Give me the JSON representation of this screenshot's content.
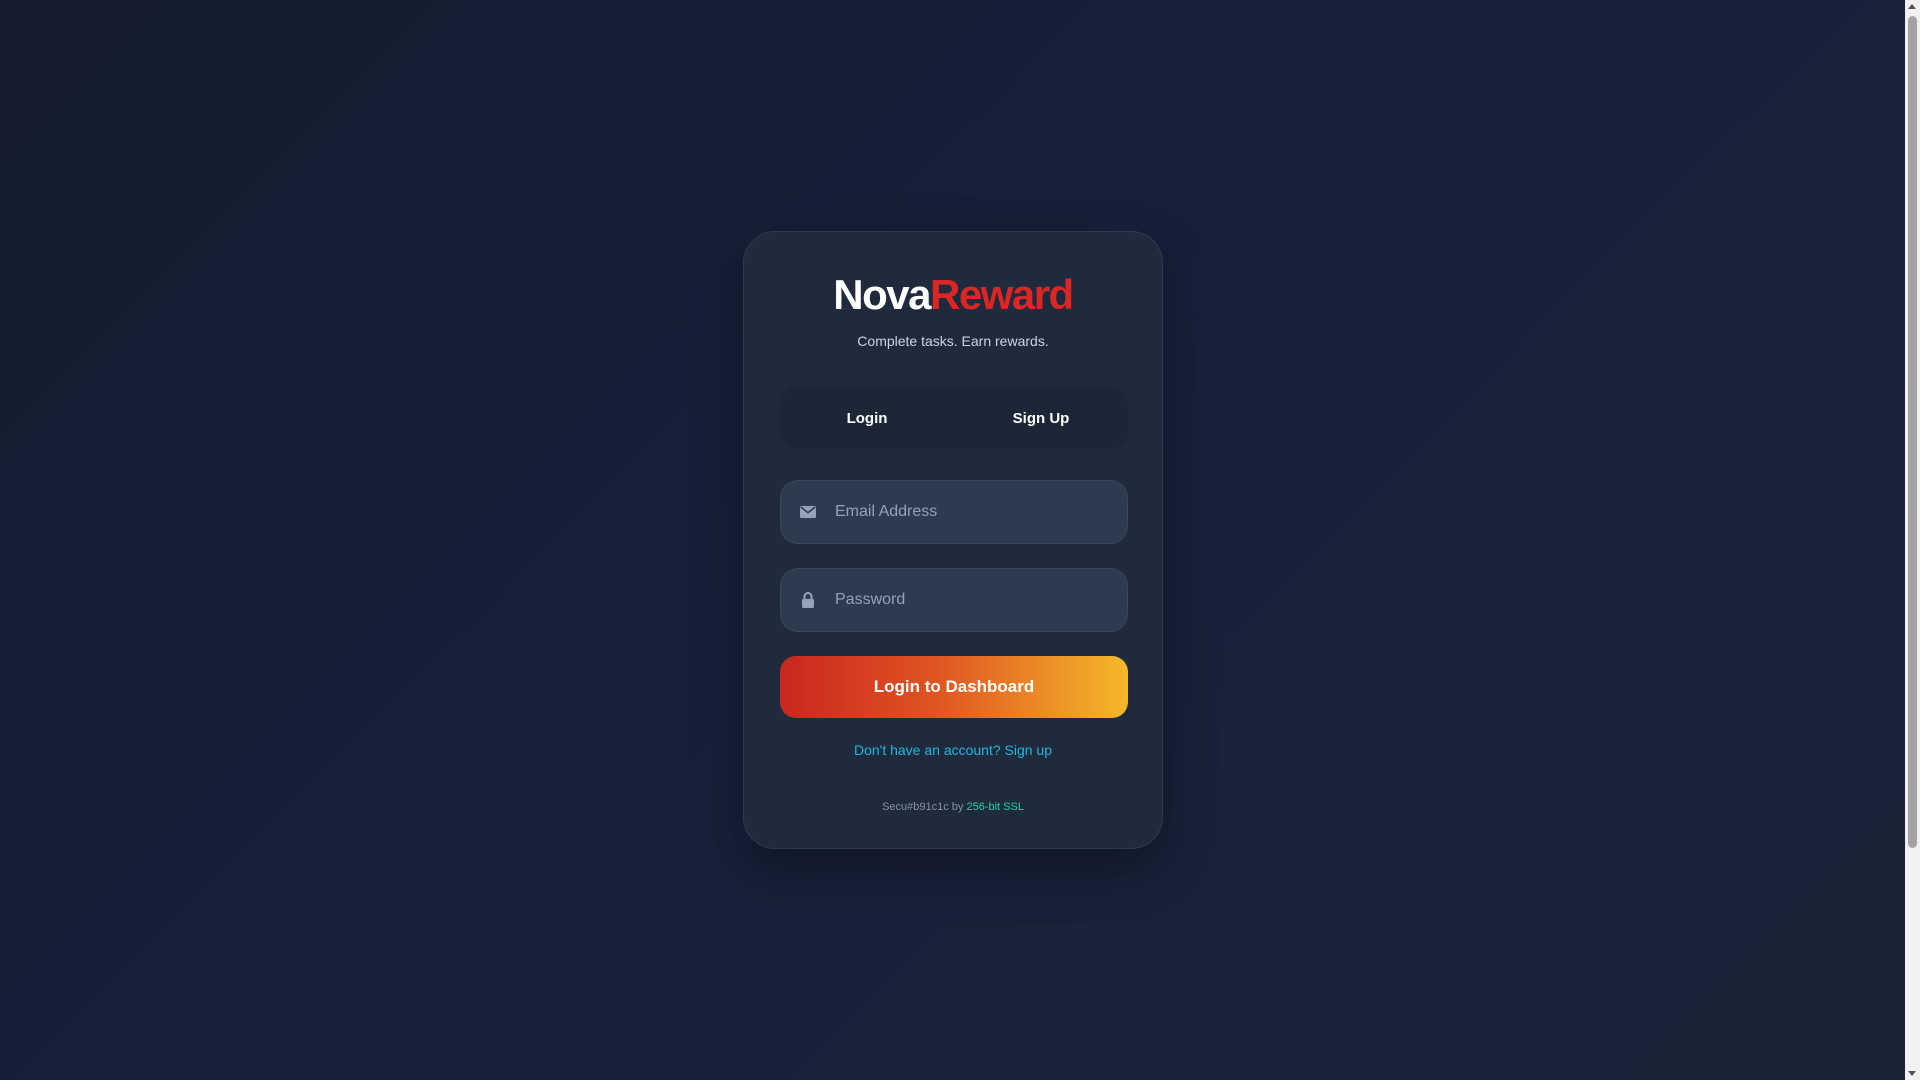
{
  "brand": {
    "name_part1": "Nova",
    "name_part2": "Reward"
  },
  "tagline": "Complete tasks. Earn rewards.",
  "tabs": [
    {
      "label": "Login"
    },
    {
      "label": "Sign Up"
    }
  ],
  "form": {
    "email": {
      "placeholder": "Email Address",
      "value": ""
    },
    "password": {
      "placeholder": "Password",
      "value": ""
    },
    "submit_label": "Login to Dashboard"
  },
  "signup_prompt": "Don't have an account? Sign up",
  "security": {
    "prefix": "Secu#b91c1c by ",
    "highlight": "256-bit SSL"
  },
  "icons": {
    "email": "envelope-icon",
    "password": "lock-icon"
  },
  "colors": {
    "accent_red": "#dc2626",
    "link": "#22b8e0",
    "ssl": "#22d3a0",
    "button_gradient": [
      "#c9261f",
      "#e05522",
      "#f5b82a"
    ]
  }
}
